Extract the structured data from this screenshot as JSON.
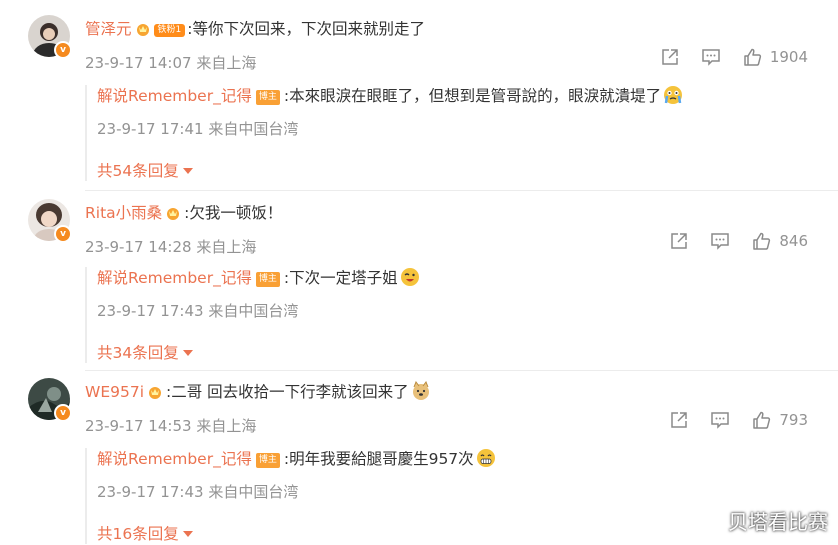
{
  "comments": [
    {
      "username": "管泽元",
      "fan_badge": "铁粉1",
      "text": ":等你下次回来，下次回来就别走了",
      "time": "23-9-17 14:07",
      "location": "来自上海",
      "likes": "1904",
      "reply": {
        "username": "解说Remember_记得",
        "host_badge": "博主",
        "text": ":本來眼淚在眼眶了，但想到是管哥說的，眼淚就潰堤了",
        "time": "23-9-17 17:41",
        "location": "来自中国台湾"
      },
      "more_replies": "共54条回复"
    },
    {
      "username": "Rita小雨桑",
      "text": ":欠我一顿饭！",
      "time": "23-9-17 14:28",
      "location": "来自上海",
      "likes": "846",
      "reply": {
        "username": "解说Remember_记得",
        "host_badge": "博主",
        "text": ":下次一定塔子姐",
        "time": "23-9-17 17:43",
        "location": "来自中国台湾"
      },
      "more_replies": "共34条回复"
    },
    {
      "username": "WE957i",
      "text": ":二哥 回去收拾一下行李就该回来了",
      "time": "23-9-17 14:53",
      "location": "来自上海",
      "likes": "793",
      "reply": {
        "username": "解说Remember_记得",
        "host_badge": "博主",
        "text": ":明年我要給腿哥慶生957次",
        "time": "23-9-17 17:43",
        "location": "来自中国台湾"
      },
      "more_replies": "共16条回复"
    }
  ],
  "watermark": "贝塔看比赛",
  "colors": {
    "accent": "#eb7350",
    "meta": "#939393",
    "badge": "#f9a035"
  }
}
